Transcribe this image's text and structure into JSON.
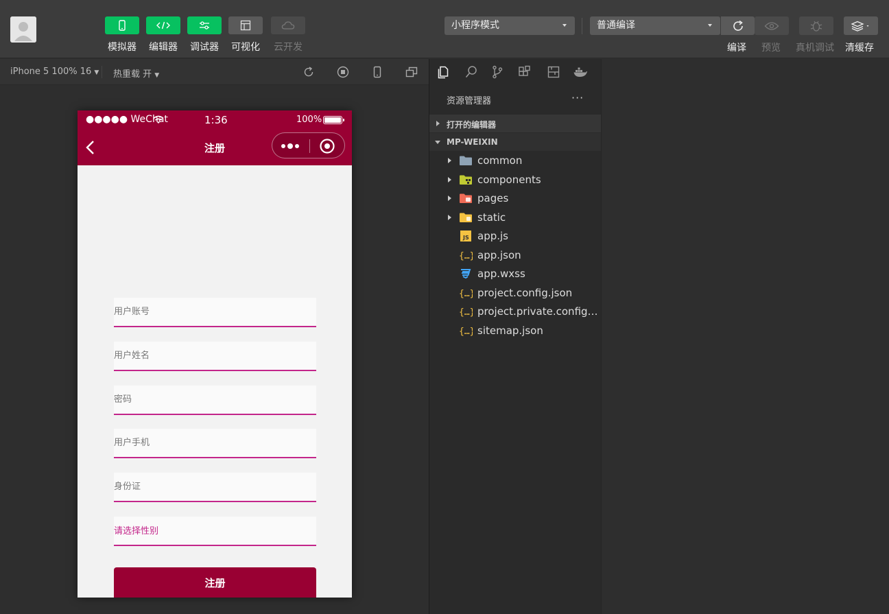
{
  "toolbar": {
    "tools": [
      {
        "label": "模拟器",
        "style": "green",
        "icon": "phone-icon"
      },
      {
        "label": "编辑器",
        "style": "green",
        "icon": "code-icon"
      },
      {
        "label": "调试器",
        "style": "green",
        "icon": "sliders-icon"
      },
      {
        "label": "可视化",
        "style": "gray",
        "icon": "layout-icon"
      },
      {
        "label": "云开发",
        "style": "dim",
        "icon": "cloud-icon"
      }
    ],
    "mode_select": "小程序模式",
    "compile_select": "普通编译",
    "compile_label": "编译",
    "preview_label": "预览",
    "remote_debug_label": "真机调试",
    "clear_cache_label": "清缓存"
  },
  "simbar": {
    "device": "iPhone 5 100% 16",
    "hot_reload": "热重载 开"
  },
  "phone": {
    "carrier": "●●●●● WeChat",
    "time": "1:36",
    "battery": "100%",
    "nav_title": "注册",
    "fields": [
      {
        "placeholder": "用户账号"
      },
      {
        "placeholder": "用户姓名"
      },
      {
        "placeholder": "密码"
      },
      {
        "placeholder": "用户手机"
      },
      {
        "placeholder": "身份证"
      }
    ],
    "gender_picker": "请选择性别",
    "submit_label": "注册"
  },
  "explorer": {
    "title": "资源管理器",
    "more": "···",
    "open_editors": "打开的编辑器",
    "project": "MP-WEIXIN",
    "items": [
      {
        "name": "common",
        "type": "folder",
        "icon": "folder-icon"
      },
      {
        "name": "components",
        "type": "folder",
        "icon": "components-folder-icon"
      },
      {
        "name": "pages",
        "type": "folder",
        "icon": "pages-folder-icon"
      },
      {
        "name": "static",
        "type": "folder",
        "icon": "static-folder-icon"
      },
      {
        "name": "app.js",
        "type": "file",
        "icon": "js-file-icon"
      },
      {
        "name": "app.json",
        "type": "file",
        "icon": "json-file-icon"
      },
      {
        "name": "app.wxss",
        "type": "file",
        "icon": "css-file-icon"
      },
      {
        "name": "project.config.json",
        "type": "file",
        "icon": "json-file-icon"
      },
      {
        "name": "project.private.config.json",
        "type": "file",
        "icon": "json-file-icon"
      },
      {
        "name": "sitemap.json",
        "type": "file",
        "icon": "json-file-icon"
      }
    ]
  },
  "colors": {
    "brand_green": "#07c160",
    "nav_red": "#990033",
    "field_underline": "#c3258a"
  }
}
